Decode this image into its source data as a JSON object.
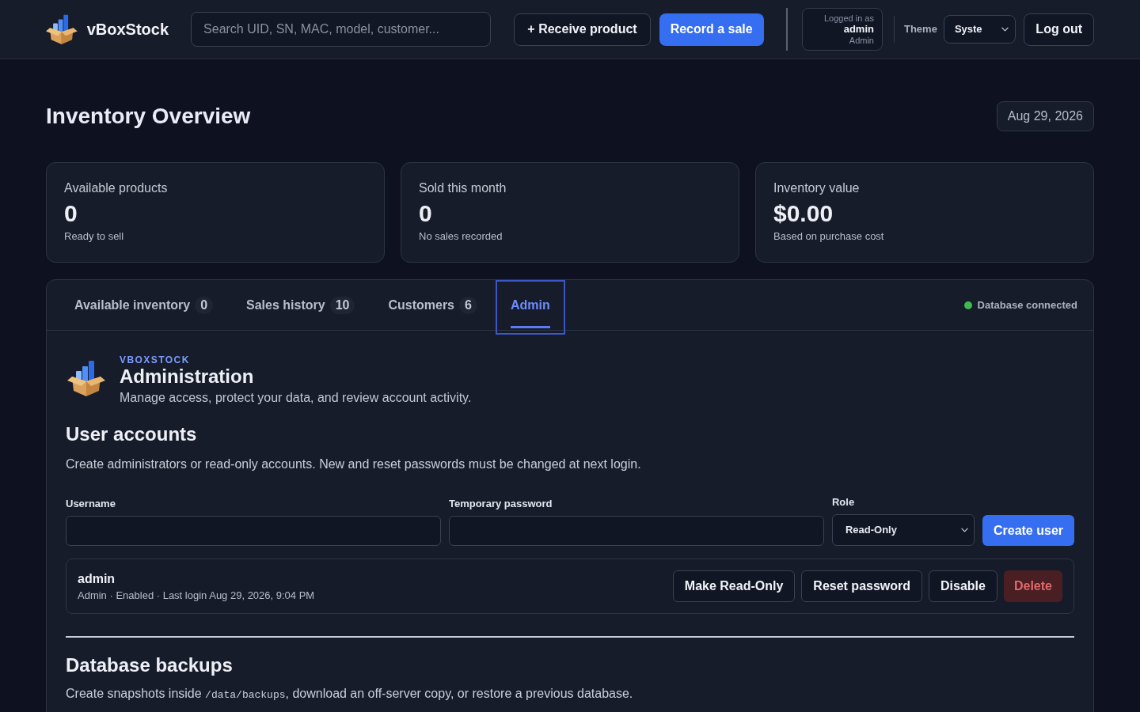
{
  "header": {
    "brand": "vBoxStock",
    "search": {
      "placeholder": "Search UID, SN, MAC, model, customer..."
    },
    "actions": [
      {
        "label": "+ Receive product",
        "kind": "outline"
      },
      {
        "label": "Record a sale",
        "kind": "primary"
      }
    ],
    "session": {
      "caption": "Logged in as",
      "user": "admin",
      "role": "Admin"
    },
    "theme": {
      "label": "Theme",
      "value": "Syste"
    },
    "logout": "Log out"
  },
  "page": {
    "title": "Inventory Overview",
    "date": "Aug 29, 2026"
  },
  "stats": [
    {
      "label": "Available products",
      "value": "0",
      "note": "Ready to sell"
    },
    {
      "label": "Sold this month",
      "value": "0",
      "note": "No sales recorded"
    },
    {
      "label": "Inventory value",
      "value": "$0.00",
      "note": "Based on purchase cost"
    }
  ],
  "tabs": [
    {
      "label": "Available inventory",
      "count": "0",
      "selected": false
    },
    {
      "label": "Sales history",
      "count": "10",
      "selected": false
    },
    {
      "label": "Customers",
      "count": "6",
      "selected": false
    },
    {
      "label": "Admin",
      "selected": true
    }
  ],
  "status": {
    "label": "Database connected",
    "connected": true
  },
  "admin": {
    "eyebrow": "VBOXSTOCK",
    "title": "Administration",
    "subtitle": "Manage access, protect your data, and review account activity."
  },
  "users_section": {
    "title": "User accounts",
    "description": "Create administrators or read-only accounts. New and reset passwords must be changed at next login.",
    "fields": [
      {
        "label": "Username",
        "kind": "text"
      },
      {
        "label": "Temporary password",
        "kind": "password"
      },
      {
        "label": "Role",
        "kind": "select",
        "value": "Read-Only"
      }
    ],
    "submit": "Create user",
    "users": [
      {
        "name": "admin",
        "meta": "Admin · Enabled · Last login Aug 29, 2026, 9:04 PM",
        "actions": [
          {
            "label": "Make Read-Only",
            "kind": "default"
          },
          {
            "label": "Reset password",
            "kind": "default"
          },
          {
            "label": "Disable",
            "kind": "default"
          },
          {
            "label": "Delete",
            "kind": "danger"
          }
        ]
      }
    ]
  },
  "backups": {
    "title": "Database backups",
    "description": {
      "before": "Create snapshots inside ",
      "code": "/data/backups",
      "after": ", download an off-server copy, or restore a previous database."
    }
  }
}
